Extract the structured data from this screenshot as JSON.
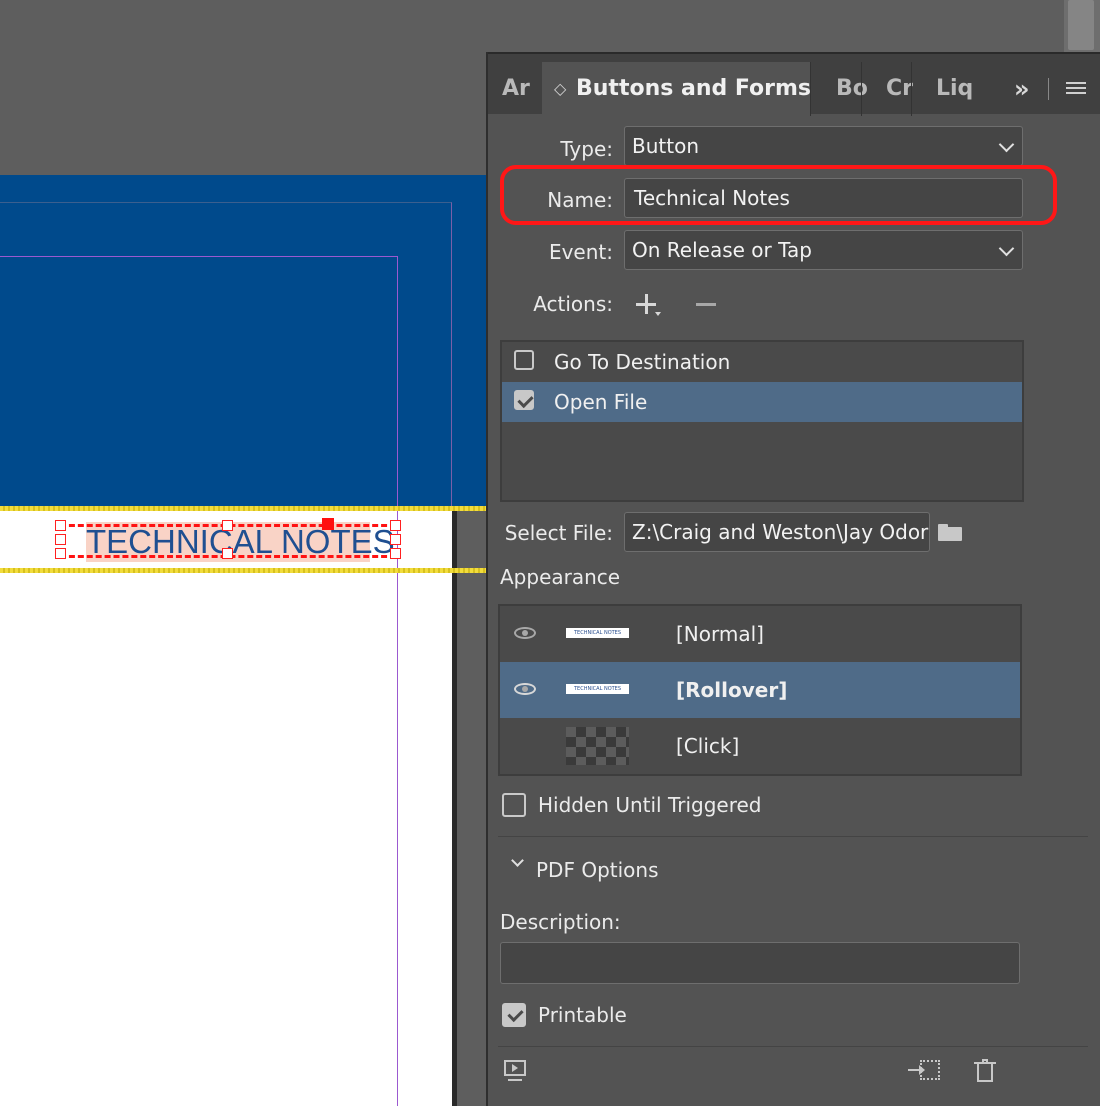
{
  "document": {
    "button_text": "TECHNICAL NOTES"
  },
  "panel": {
    "tabs": [
      {
        "label": "Ar",
        "active": false
      },
      {
        "label": "Buttons and Forms",
        "active": true
      },
      {
        "label": "Bo",
        "active": false
      },
      {
        "label": "Cr",
        "active": false
      },
      {
        "label": "Liq",
        "active": false
      }
    ],
    "overflow_label": "»",
    "type_label": "Type:",
    "type_value": "Button",
    "name_label": "Name:",
    "name_value": "Technical Notes",
    "event_label": "Event:",
    "event_value": "On Release or Tap",
    "actions_label": "Actions:",
    "actions": [
      {
        "label": "Go To Destination",
        "checked": false,
        "selected": false
      },
      {
        "label": "Open File",
        "checked": true,
        "selected": true
      }
    ],
    "select_file_label": "Select File:",
    "select_file_value": "Z:\\Craig and Weston\\Jay Odor",
    "appearance_label": "Appearance",
    "appearance_states": [
      {
        "label": "[Normal]",
        "thumb_text": "TECHNICAL NOTES",
        "visible": true,
        "selected": false
      },
      {
        "label": "[Rollover]",
        "thumb_text": "TECHNICAL NOTES",
        "visible": true,
        "selected": true
      },
      {
        "label": "[Click]",
        "thumb_text": "",
        "visible": false,
        "selected": false
      }
    ],
    "hidden_until_triggered_label": "Hidden Until Triggered",
    "hidden_until_triggered_checked": false,
    "pdf_options_label": "PDF Options",
    "description_label": "Description:",
    "description_value": "",
    "printable_label": "Printable",
    "printable_checked": true
  },
  "colors": {
    "highlight": "#ff1717",
    "selection_row": "#4f6b88",
    "document_blue": "#004a8c",
    "button_text": "#1f4f91"
  },
  "icons": [
    "plus-icon",
    "minus-icon",
    "folder-icon",
    "eye-icon",
    "chevron-down-icon",
    "menu-icon",
    "preview-icon",
    "convert-to-object-icon",
    "trash-icon"
  ]
}
